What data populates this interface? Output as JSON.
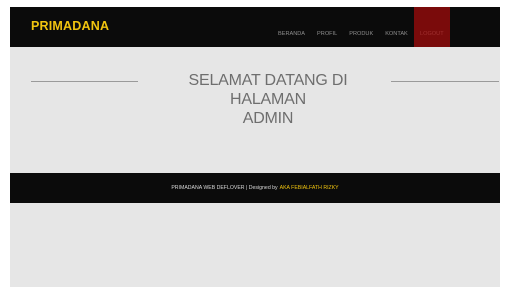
{
  "navbar": {
    "brand": "PRIMADANA",
    "items": [
      {
        "label": "BERANDA"
      },
      {
        "label": "PROFIL"
      },
      {
        "label": "PRODUK"
      },
      {
        "label": "KONTAK"
      },
      {
        "label": "LOGOUT",
        "active": true
      }
    ]
  },
  "hero": {
    "title_line1": "SELAMAT DATANG DI HALAMAN",
    "title_line2": "ADMIN"
  },
  "footer": {
    "text": "PRIMADANA WEB DEFLOVER | Designed by",
    "author": "AKA FEBIALFATH RIZKY"
  },
  "colors": {
    "accent": "#f1c40f",
    "bar_background": "#0b0b0b",
    "active_menu": "#7a0b0b",
    "page_background": "#e6e6e6"
  }
}
